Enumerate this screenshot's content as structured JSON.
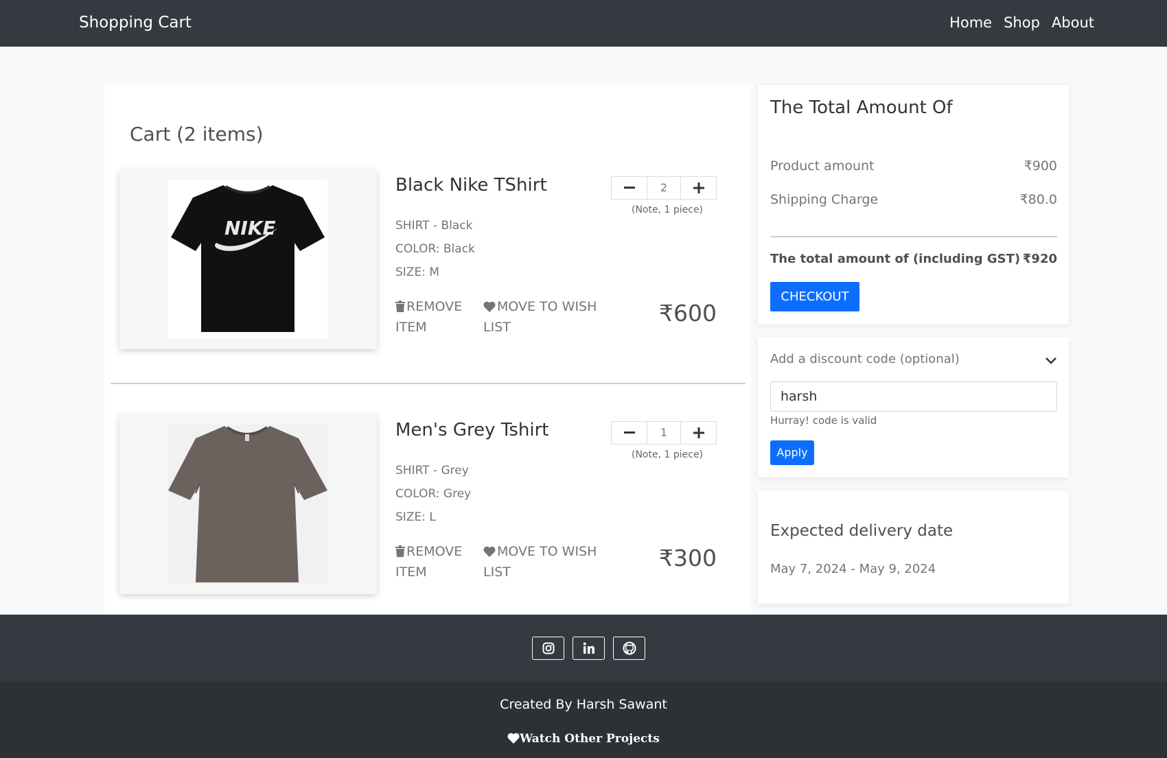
{
  "navbar": {
    "brand": "Shopping Cart",
    "links": [
      "Home",
      "Shop",
      "About"
    ]
  },
  "cart": {
    "title": "Cart (2 items)",
    "items": [
      {
        "name": "Black Nike TShirt",
        "shirt": "SHIRT - Black",
        "color": "COLOR: Black",
        "size": "SIZE: M",
        "quantity": "2",
        "note": "(Note, 1 piece)",
        "remove_label": "REMOVE ITEM",
        "wish_label": "MOVE TO WISH LIST",
        "price": "₹600",
        "shirt_color": "#111111"
      },
      {
        "name": "Men's Grey Tshirt",
        "shirt": "SHIRT - Grey",
        "color": "COLOR: Grey",
        "size": "SIZE: L",
        "quantity": "1",
        "note": "(Note, 1 piece)",
        "remove_label": "REMOVE ITEM",
        "wish_label": "MOVE TO WISH LIST",
        "price": "₹300",
        "shirt_color": "#6b625d"
      }
    ]
  },
  "summary": {
    "title": "The Total Amount Of",
    "product_label": "Product amount",
    "product_value": "₹900",
    "shipping_label": "Shipping Charge",
    "shipping_value": "₹80.0",
    "total_label": "The total amount of (including GST)",
    "total_value": "₹920",
    "checkout_label": "CHECKOUT"
  },
  "discount": {
    "header": "Add a discount code (optional)",
    "code_value": "harsh",
    "message": "Hurray! code is valid",
    "apply_label": "Apply"
  },
  "delivery": {
    "title": "Expected delivery date",
    "dates": "May 7, 2024 - May 9, 2024"
  },
  "footer": {
    "social_icons": [
      "instagram-icon",
      "linkedin-icon",
      "github-icon"
    ],
    "credit": "Created By Harsh Sawant",
    "projects": "Watch Other Projects"
  },
  "colors": {
    "navbar": "#343a40",
    "footer_dark": "#2d3136",
    "primary": "#0d6efd",
    "page_bg": "#f8f9fa"
  }
}
